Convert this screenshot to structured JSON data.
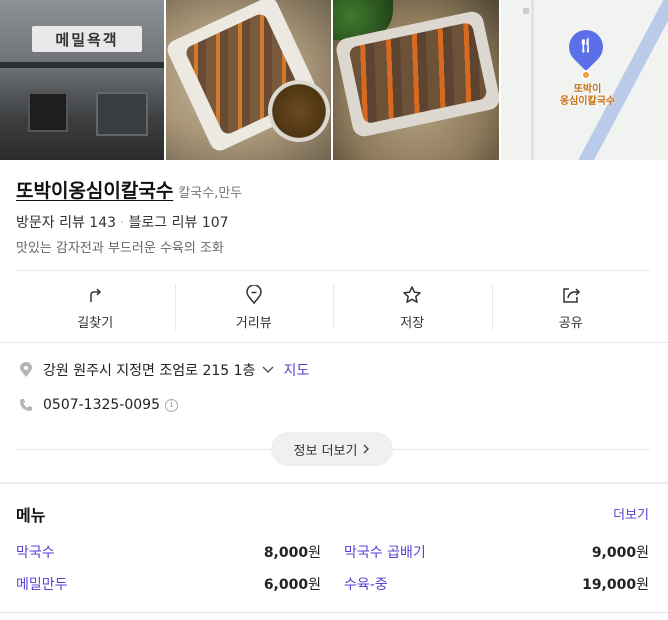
{
  "photos": {
    "storefront_sign": "메밀욕객",
    "map_label_line1": "또박이",
    "map_label_line2": "옹심이칼국수"
  },
  "place": {
    "name": "또박이옹심이칼국수",
    "category": "칼국수,만두",
    "visitor_reviews": "방문자 리뷰 143",
    "separator": "·",
    "blog_reviews": "블로그 리뷰 107",
    "description": "맛있는 감자전과 부드러운 수육의 조화"
  },
  "actions": {
    "directions": "길찾기",
    "street_view": "거리뷰",
    "save": "저장",
    "share": "공유"
  },
  "info": {
    "address": "강원 원주시 지정면 조엄로 215 1층",
    "map_link": "지도",
    "phone": "0507-1325-0095",
    "info_glyph": "i",
    "more_info": "정보 더보기"
  },
  "menu": {
    "title": "메뉴",
    "more": "더보기",
    "items": [
      {
        "name": "막국수",
        "price": "8,000",
        "unit": "원"
      },
      {
        "name": "막국수 곱배기",
        "price": "9,000",
        "unit": "원"
      },
      {
        "name": "메밀만두",
        "price": "6,000",
        "unit": "원"
      },
      {
        "name": "수육-중",
        "price": "19,000",
        "unit": "원"
      }
    ]
  },
  "colors": {
    "accent": "#5a3fd4",
    "map_pin": "#5b6fe9"
  }
}
